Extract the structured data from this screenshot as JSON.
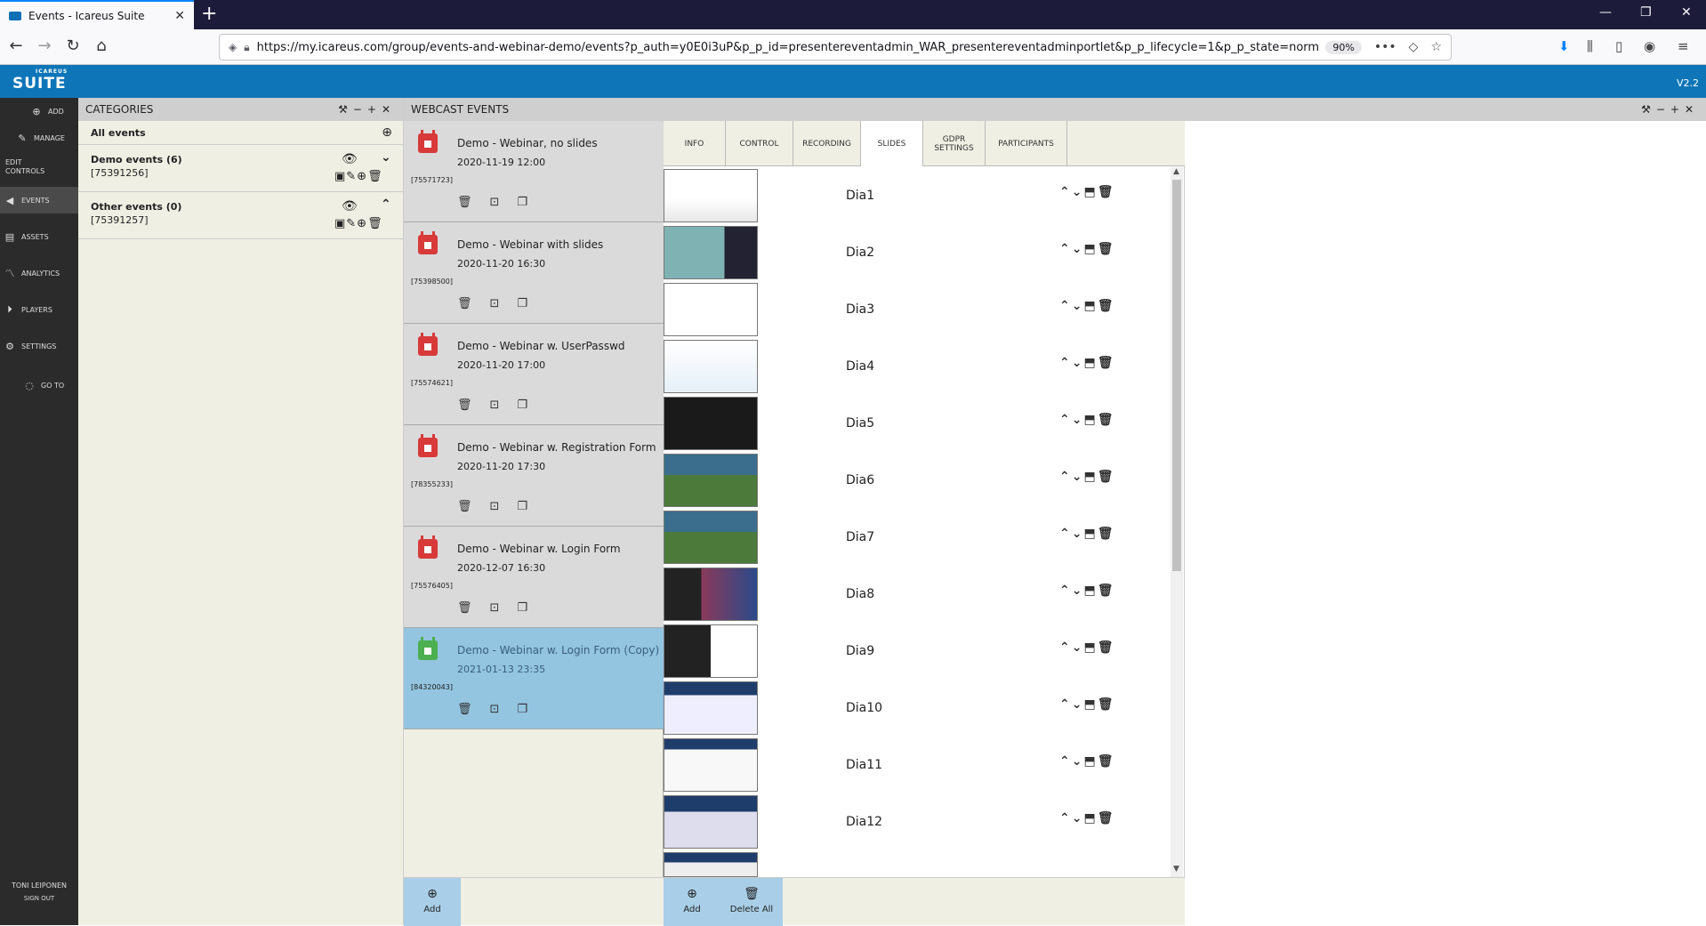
{
  "browser": {
    "tab_title": "Events - Icareus Suite",
    "url": "https://my.icareus.com/group/events-and-webinar-demo/events?p_auth=y0E0i3uP&p_p_id=presentereventadmin_WAR_presentereventadminportlet&p_p_lifecycle=1&p_p_state=normal&",
    "zoom": "90%"
  },
  "app": {
    "logo_small": "ICAREUS",
    "logo": "SUITE",
    "version": "V2.2",
    "accent": "#0e76b8"
  },
  "sidenav": {
    "items": [
      {
        "label": "ADD",
        "icon": "add-icon"
      },
      {
        "label": "MANAGE",
        "icon": "manage-icon"
      },
      {
        "label": "EDIT CONTROLS",
        "icon": "edit-icon"
      },
      {
        "label": "EVENTS",
        "icon": "events-icon",
        "active": true
      },
      {
        "label": "ASSETS",
        "icon": "assets-icon"
      },
      {
        "label": "ANALYTICS",
        "icon": "analytics-icon"
      },
      {
        "label": "PLAYERS",
        "icon": "players-icon"
      },
      {
        "label": "SETTINGS",
        "icon": "settings-icon"
      },
      {
        "label": "GO TO",
        "icon": "goto-icon"
      }
    ],
    "user": "TONI LEIPONEN",
    "signout": "SIGN OUT"
  },
  "categories": {
    "title": "CATEGORIES",
    "all": "All events",
    "items": [
      {
        "name": "Demo events (6)",
        "id": "[75391256]"
      },
      {
        "name": "Other events (0)",
        "id": "[75391257]"
      }
    ]
  },
  "webcast": {
    "title": "WEBCAST EVENTS",
    "events": [
      {
        "title": "Demo - Webinar, no slides",
        "date": "2020-11-19 12:00",
        "id": "[75571723]"
      },
      {
        "title": "Demo - Webinar with slides",
        "date": "2020-11-20 16:30",
        "id": "[75398500]"
      },
      {
        "title": "Demo - Webinar w. UserPasswd",
        "date": "2020-11-20 17:00",
        "id": "[75574621]"
      },
      {
        "title": "Demo - Webinar w. Registration Form",
        "date": "2020-11-20 17:30",
        "id": "[78355233]"
      },
      {
        "title": "Demo - Webinar w. Login Form",
        "date": "2020-12-07 16:30",
        "id": "[75576405]"
      },
      {
        "title": "Demo - Webinar w. Login Form (Copy)",
        "date": "2021-01-13 23:35",
        "id": "[84320043]",
        "selected": true
      }
    ],
    "add_label": "Add"
  },
  "detail": {
    "tabs": [
      "INFO",
      "CONTROL",
      "RECORDING",
      "SLIDES",
      "GDPR SETTINGS",
      "PARTICIPANTS"
    ],
    "active_tab": "SLIDES",
    "slides": [
      "Dia1",
      "Dia2",
      "Dia3",
      "Dia4",
      "Dia5",
      "Dia6",
      "Dia7",
      "Dia8",
      "Dia9",
      "Dia10",
      "Dia11",
      "Dia12"
    ],
    "add_label": "Add",
    "delete_all_label": "Delete All"
  }
}
